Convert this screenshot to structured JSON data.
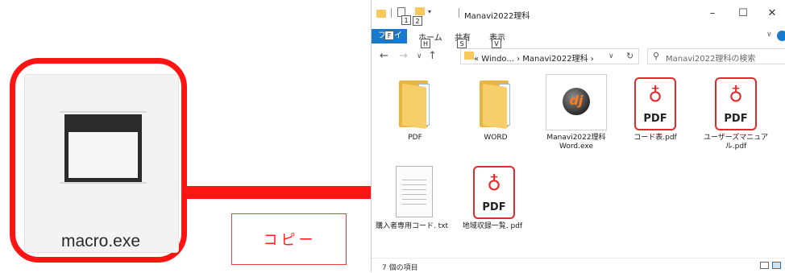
{
  "macro": {
    "filename": "macro.exe"
  },
  "copy_label": "コピー",
  "explorer": {
    "title": "Manavi2022理科",
    "keytips": {
      "qat1": "1",
      "qat2": "2",
      "file": "F",
      "home": "H",
      "share": "S",
      "view": "V"
    },
    "ribbon": {
      "file": "ファイル",
      "home": "ホーム",
      "share": "共有",
      "view": "表示"
    },
    "window_buttons": {
      "minimize": "–",
      "maximize": "☐",
      "close": "✕"
    },
    "address": {
      "path": "«  Windo...  ›  Manavi2022理科  ›"
    },
    "search": {
      "placeholder": "Manavi2022理科の検索"
    },
    "items": [
      {
        "label": "PDF",
        "kind": "folder"
      },
      {
        "label": "WORD",
        "kind": "folder"
      },
      {
        "label": "Manavi2022理科 Word.exe",
        "kind": "exe"
      },
      {
        "label": "コード表.pdf",
        "kind": "pdf"
      },
      {
        "label": "ユーザーズマニュア ル.pdf",
        "kind": "pdf"
      },
      {
        "label": "購入者専用コード. txt",
        "kind": "txt"
      },
      {
        "label": "地域収録一覧. pdf",
        "kind": "pdf"
      }
    ],
    "pdf_badge": "PDF",
    "status": "7 個の項目"
  },
  "colors": {
    "highlight_red": "#ff1414",
    "accent_blue": "#1979ca",
    "folder_yellow": "#f7c95c"
  }
}
